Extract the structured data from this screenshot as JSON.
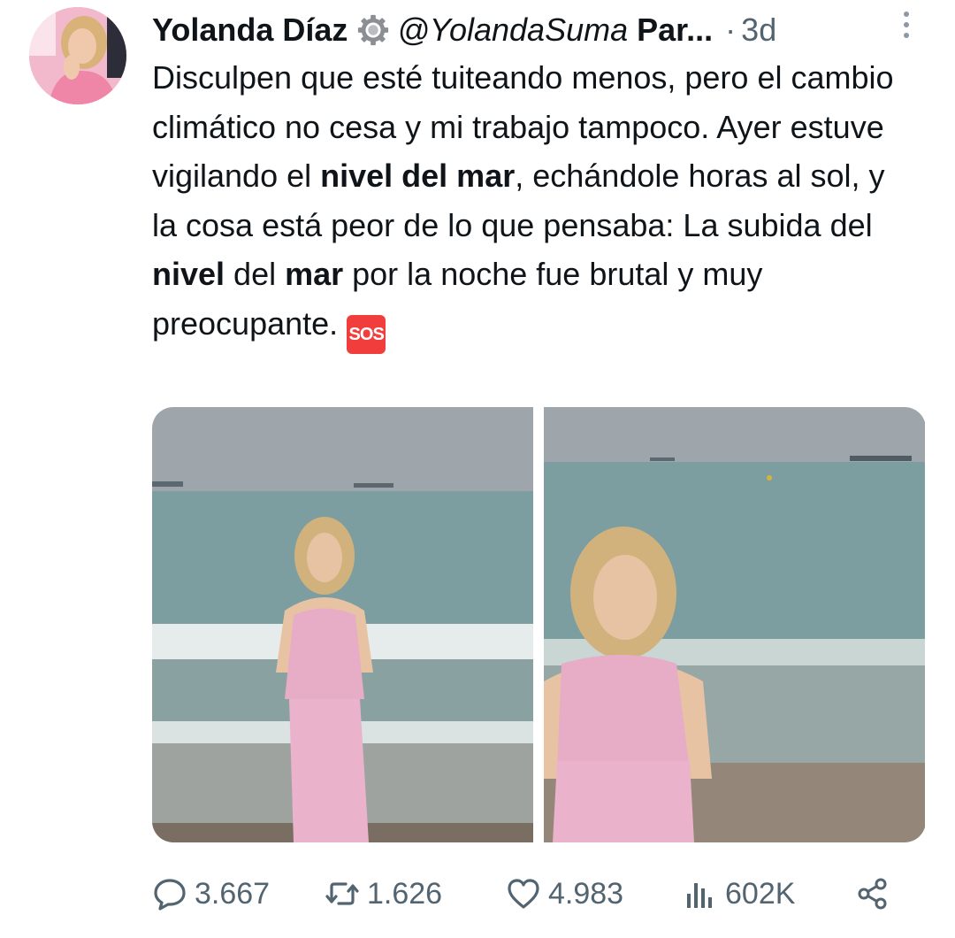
{
  "author": {
    "name": "Yolanda Díaz",
    "handle": "@YolandaSuma",
    "truncated_name": "Par...",
    "separator": "·",
    "time": "3d"
  },
  "tweet": {
    "segments": [
      {
        "text": "Disculpen que esté tuiteando menos, pero el cambio climático no cesa y mi trabajo tampoco. Ayer estuve vigilando el ",
        "bold": false
      },
      {
        "text": "nivel del mar",
        "bold": true
      },
      {
        "text": ", echándole horas al sol, y la cosa está peor de lo que pensaba: La subida del ",
        "bold": false
      },
      {
        "text": "nivel",
        "bold": true
      },
      {
        "text": " del ",
        "bold": false
      },
      {
        "text": "mar",
        "bold": true
      },
      {
        "text": " por la noche fue brutal y muy preocupante. ",
        "bold": false
      }
    ],
    "emoji": "SOS"
  },
  "actions": {
    "replies": "3.667",
    "retweets": "1.626",
    "likes": "4.983",
    "views": "602K"
  },
  "icons": {
    "verified": "gear-badge-icon",
    "more": "more-vertical-icon",
    "reply": "reply-icon",
    "retweet": "retweet-icon",
    "like": "heart-icon",
    "views": "views-icon",
    "share": "share-icon"
  },
  "colors": {
    "text": "#0f1419",
    "secondary": "#536471",
    "sos": "#f23d3d"
  }
}
